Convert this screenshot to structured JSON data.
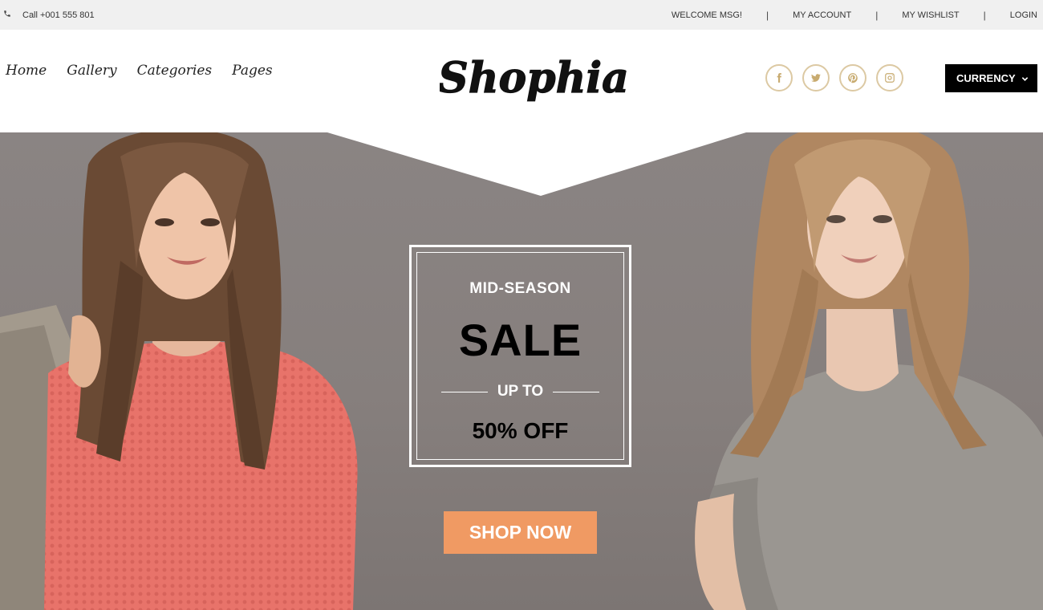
{
  "topbar": {
    "phone_icon": "phone-icon",
    "phone_text": "Call +001 555 801",
    "links": [
      "WELCOME MSG!",
      "MY ACCOUNT",
      "MY WISHLIST",
      "LOGIN"
    ],
    "separator": "|"
  },
  "header": {
    "nav": [
      "Home",
      "Gallery",
      "Categories",
      "Pages"
    ],
    "logo_text": "Shophia",
    "socials": [
      "facebook-icon",
      "twitter-icon",
      "pinterest-icon",
      "instagram-icon"
    ],
    "currency_label": "CURRENCY",
    "currency_icon": "chevron-down-icon"
  },
  "hero": {
    "kicker": "MID-SEASON",
    "headline": "SALE",
    "upto": "UP TO",
    "offer": "50% OFF",
    "cta": "SHOP NOW"
  },
  "colors": {
    "topbar_bg": "#f0f0f0",
    "hero_bg": "#867f7d",
    "social_accent": "#c8ab70",
    "currency_bg": "#000000",
    "cta_bg": "#f09a63"
  }
}
